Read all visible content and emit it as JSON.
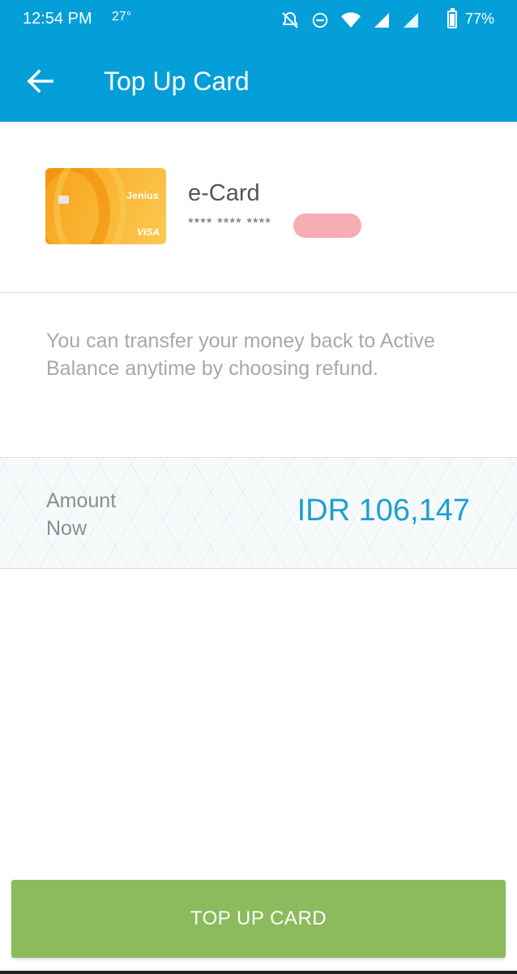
{
  "status_bar": {
    "time": "12:54 PM",
    "temperature": "27°",
    "battery": "77%",
    "icons": [
      "bell-off-icon",
      "do-not-disturb-icon",
      "wifi-icon",
      "signal-icon",
      "signal-icon",
      "battery-charging-icon"
    ]
  },
  "app_bar": {
    "back_icon": "arrow-left-icon",
    "title": "Top Up Card"
  },
  "card": {
    "name": "e-Card",
    "number_masked": "**** **** ****",
    "brand": "Jenius",
    "network": "VISA"
  },
  "info": {
    "text": "You can transfer your money back to Active Balance anytime by choosing refund."
  },
  "amount": {
    "label": "Amount Now",
    "value": "IDR 106,147"
  },
  "actions": {
    "top_up_label": "TOP UP CARD"
  },
  "colors": {
    "primary": "#049fd9",
    "amount_text": "#1ea0d0",
    "button": "#8bbb5c"
  }
}
